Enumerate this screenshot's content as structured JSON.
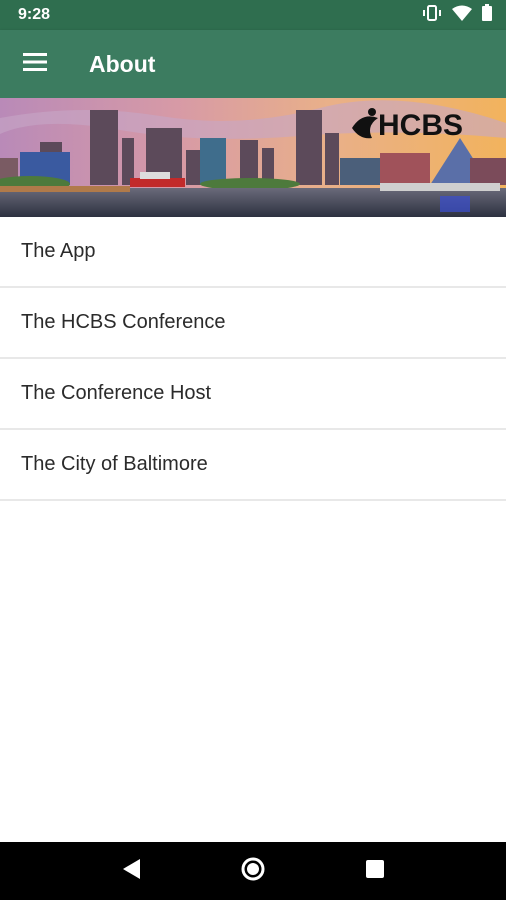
{
  "status_bar": {
    "time": "9:28",
    "icons": [
      "vibrate-icon",
      "wifi-icon",
      "battery-icon"
    ]
  },
  "app_bar": {
    "title": "About",
    "menu_icon": "hamburger-menu-icon",
    "color": "#3c7c60"
  },
  "banner": {
    "logo_text": "HCBS"
  },
  "about_items": [
    {
      "label": "The App"
    },
    {
      "label": "The HCBS Conference"
    },
    {
      "label": "The Conference Host"
    },
    {
      "label": "The City of Baltimore"
    }
  ],
  "nav_bar": {
    "buttons": [
      "back-icon",
      "home-icon",
      "recents-icon"
    ]
  }
}
